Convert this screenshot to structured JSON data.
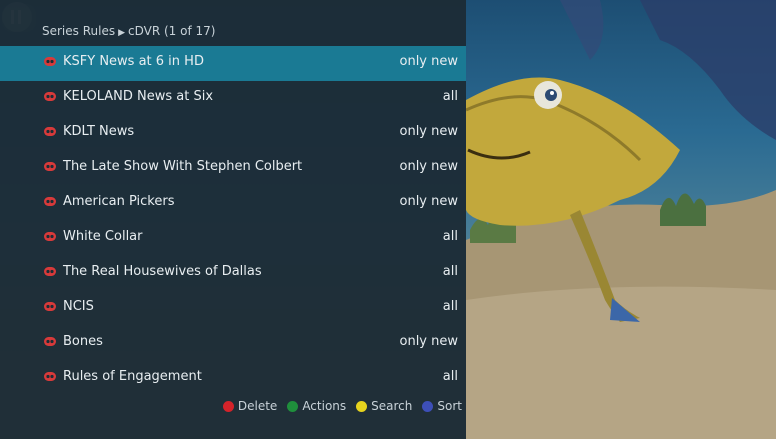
{
  "header": {
    "section": "Series Rules",
    "location": "cDVR (1 of 17)"
  },
  "series_rules": [
    {
      "title": "KSFY News at 6 in HD",
      "rule": "only new",
      "selected": true
    },
    {
      "title": "KELOLAND News at Six",
      "rule": "all"
    },
    {
      "title": "KDLT News",
      "rule": "only new"
    },
    {
      "title": "The Late Show With Stephen Colbert",
      "rule": "only new"
    },
    {
      "title": "American Pickers",
      "rule": "only new"
    },
    {
      "title": "White Collar",
      "rule": "all"
    },
    {
      "title": "The Real Housewives of Dallas",
      "rule": "all"
    },
    {
      "title": "NCIS",
      "rule": "all"
    },
    {
      "title": "Bones",
      "rule": "only new"
    },
    {
      "title": "Rules of Engagement",
      "rule": "all"
    }
  ],
  "legend": [
    {
      "label": "Delete",
      "color": "#d4232a"
    },
    {
      "label": "Actions",
      "color": "#1f8f3c"
    },
    {
      "label": "Search",
      "color": "#e6d31e"
    },
    {
      "label": "Sort",
      "color": "#3d4fb8"
    }
  ],
  "colors": {
    "selected_row": "#1a7a94",
    "record_icon": "#d83a3a"
  },
  "icons": {
    "record": "series-record-icon",
    "channel_logo": "channel-logo-icon",
    "watermark": "watermark-icon"
  }
}
